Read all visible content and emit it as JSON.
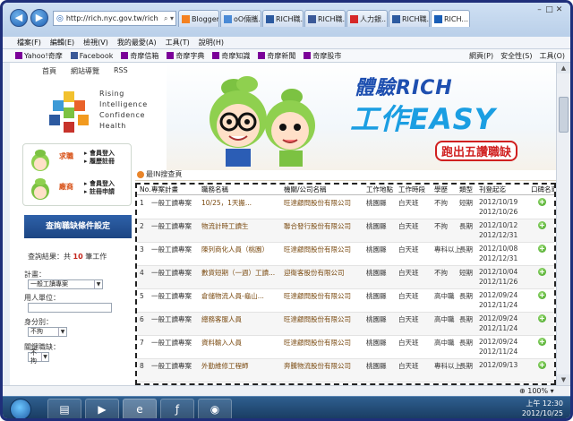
{
  "browser": {
    "url": "http://rich.nyc.gov.tw/rich",
    "tabs": [
      {
        "label": "Blogger...",
        "icon_color": "#f48120"
      },
      {
        "label": "oO倆攜...",
        "icon_color": "#4a8ad6"
      },
      {
        "label": "RICH職...",
        "icon_color": "#2c5aa0"
      },
      {
        "label": "RICH職...",
        "icon_color": "#3b5998"
      },
      {
        "label": "人力銀...",
        "icon_color": "#d62828"
      },
      {
        "label": "RICH職...",
        "icon_color": "#2c5aa0"
      },
      {
        "label": "RICH...",
        "icon_color": "#1a5eb6",
        "active": true
      }
    ],
    "menu": [
      "檔案(F)",
      "編輯(E)",
      "檢視(V)",
      "我的最愛(A)",
      "工具(T)",
      "說明(H)"
    ],
    "favorites": [
      "Yahoo!奇摩",
      "Facebook",
      "奇摩信箱",
      "奇摩字典",
      "奇摩知識",
      "奇摩新聞",
      "奇摩股市"
    ],
    "toolbar": [
      "網頁(P)",
      "安全性(S)",
      "工具(O)"
    ],
    "zoom": "100%"
  },
  "site": {
    "nav": [
      "首頁",
      "網站導覽",
      "RSS"
    ],
    "logo_words": [
      "Rising",
      "Intelligence",
      "Confidence",
      "Health"
    ],
    "hero_title1": "體驗RICH",
    "hero_title2": "工作EASY",
    "hero_slogan": "跑出五讚職缺",
    "jobs_box": {
      "seeker_label": "求職",
      "seeker_links": [
        "會員登入",
        "履歷註冊"
      ],
      "employer_label": "廠商",
      "employer_links": [
        "會員登入",
        "註冊申請"
      ]
    },
    "search_title": "查詢職缺條件設定",
    "result_prefix": "查詢結果：共",
    "result_count": "10",
    "result_suffix": "筆工作",
    "fields": [
      {
        "label": "計畫：",
        "value": "一般工讀專案"
      },
      {
        "label": "用人單位：",
        "value": ""
      },
      {
        "label": "身分別：",
        "value": "不拘"
      },
      {
        "label": "關鍵職缺：",
        "value": "不拘"
      }
    ]
  },
  "table": {
    "section_title": "最IN搜查頁",
    "headers": [
      "No.",
      "專案計畫",
      "職務名稱",
      "機關/公司名稱",
      "工作地點",
      "工作時段",
      "學歷",
      "類型",
      "刊登起迄",
      "口碑名單"
    ],
    "rows": [
      {
        "no": "1",
        "plan": "一般工讀專案",
        "job": "10/25，1天搬...",
        "company": "旺達顧問股份有限公司",
        "place": "桃園縣",
        "time": "白天班",
        "edu": "不拘",
        "type": "短期",
        "start": "2012/10/19",
        "end": "2012/10/26"
      },
      {
        "no": "2",
        "plan": "一般工讀專案",
        "job": "物流計時工讀生",
        "company": "聯合發行股份有限公司",
        "place": "桃園縣",
        "time": "白天班",
        "edu": "不拘",
        "type": "長期",
        "start": "2012/10/12",
        "end": "2012/12/31"
      },
      {
        "no": "3",
        "plan": "一般工讀專案",
        "job": "陳列商化人員（桃園）",
        "company": "旺達顧問股份有限公司",
        "place": "桃園縣",
        "time": "白天班",
        "edu": "專科以上",
        "type": "長期",
        "start": "2012/10/08",
        "end": "2012/12/31"
      },
      {
        "no": "4",
        "plan": "一般工讀專案",
        "job": "數貨短期（一週）工讀...",
        "company": "迎衛客股份有限公司",
        "place": "桃園縣",
        "time": "白天班",
        "edu": "不拘",
        "type": "短期",
        "start": "2012/10/04",
        "end": "2012/11/26"
      },
      {
        "no": "5",
        "plan": "一般工讀專案",
        "job": "倉儲物流人員-龜山...",
        "company": "旺達顧問股份有限公司",
        "place": "桃園縣",
        "time": "白天班",
        "edu": "高中職",
        "type": "長期",
        "start": "2012/09/24",
        "end": "2012/11/24"
      },
      {
        "no": "6",
        "plan": "一般工讀專案",
        "job": "總務客服人員",
        "company": "旺達顧問股份有限公司",
        "place": "桃園縣",
        "time": "白天班",
        "edu": "高中職",
        "type": "長期",
        "start": "2012/09/24",
        "end": "2012/11/24"
      },
      {
        "no": "7",
        "plan": "一般工讀專案",
        "job": "資料輸入人員",
        "company": "旺達顧問股份有限公司",
        "place": "桃園縣",
        "time": "白天班",
        "edu": "高中職",
        "type": "長期",
        "start": "2012/09/24",
        "end": "2012/11/24"
      },
      {
        "no": "8",
        "plan": "一般工讀專案",
        "job": "外勤維修工程師",
        "company": "奔騰物流股份有限公司",
        "place": "桃園縣",
        "time": "白天班",
        "edu": "專科以上",
        "type": "長期",
        "start": "2012/09/13",
        "end": ""
      }
    ]
  },
  "taskbar": {
    "time": "上午 12:30",
    "date": "2012/10/25"
  }
}
